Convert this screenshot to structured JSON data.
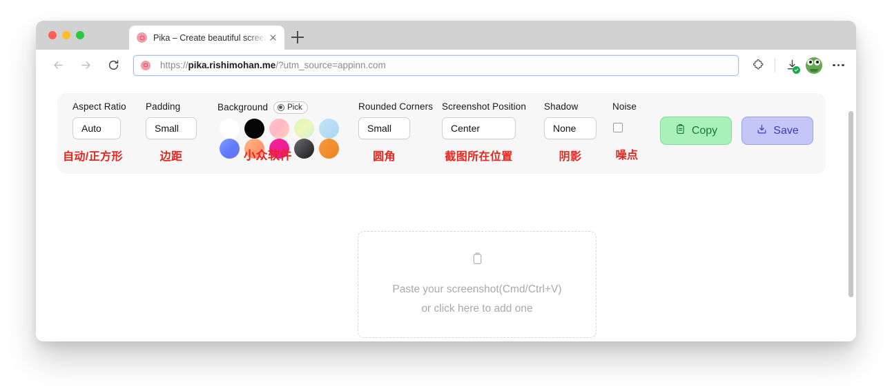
{
  "browser": {
    "tab": {
      "title": "Pika – Create beautiful screenshots",
      "favicon_name": "pika-favicon",
      "close_label": "×"
    },
    "new_tab_label": "+",
    "nav": {
      "back_icon": "back-arrow-icon",
      "forward_icon": "forward-arrow-icon",
      "reload_icon": "reload-icon",
      "extensions_icon": "extensions-puzzle-icon",
      "downloads_icon": "downloads-icon",
      "profile_icon": "frog-avatar-icon",
      "menu_icon": "more-options-icon"
    },
    "url": {
      "prefix": "https://",
      "domain": "pika.rishimohan.me",
      "suffix": "/?utm_source=appinn.com",
      "full": "https://pika.rishimohan.me/?utm_source=appinn.com"
    }
  },
  "toolbar": {
    "aspect_ratio": {
      "label": "Aspect Ratio",
      "value": "Auto",
      "annotation": "自动/正方形"
    },
    "padding": {
      "label": "Padding",
      "value": "Small",
      "annotation": "边距"
    },
    "background": {
      "label": "Background",
      "pick_label": "Pick",
      "watermark": "小众软件",
      "swatches": [
        {
          "name": "white",
          "css": "#ffffff"
        },
        {
          "name": "black",
          "css": "#050505"
        },
        {
          "name": "pink-gradient",
          "css": "linear-gradient(135deg,#ffc9c0,#ffb6c8 45%,#ffd4b5)"
        },
        {
          "name": "green-gradient",
          "css": "linear-gradient(135deg,#d8f5b8,#eef7bb 50%,#cdf0cf)"
        },
        {
          "name": "blue-gradient",
          "css": "linear-gradient(135deg,#bfe6f7,#b9dcf5 50%,#a9d8ef)"
        },
        {
          "name": "indigo-gradient",
          "css": "linear-gradient(135deg,#7f9cff,#5f7bfb 55%,#6f6df0)"
        },
        {
          "name": "orange-gradient",
          "css": "linear-gradient(135deg,#ffb787,#ff9b6e 55%,#ff8f79)"
        },
        {
          "name": "magenta",
          "css": "linear-gradient(135deg,#f8268f,#e8169c)"
        },
        {
          "name": "charcoal",
          "css": "linear-gradient(135deg,#6b6b6e,#3b3b3f 60%,#1d1d20)"
        },
        {
          "name": "orange",
          "css": "linear-gradient(135deg,#f79a3c,#ef8221)"
        }
      ]
    },
    "rounded_corners": {
      "label": "Rounded Corners",
      "value": "Small",
      "annotation": "圆角"
    },
    "screenshot_position": {
      "label": "Screenshot Position",
      "value": "Center",
      "annotation": "截图所在位置"
    },
    "shadow": {
      "label": "Shadow",
      "value": "None",
      "annotation": "阴影"
    },
    "noise": {
      "label": "Noise",
      "checked": false,
      "annotation": "噪点"
    },
    "copy_button": {
      "label": "Copy",
      "icon": "clipboard-icon",
      "color": "#aaf0bb"
    },
    "save_button": {
      "label": "Save",
      "icon": "download-icon",
      "color": "#c3c6f7"
    }
  },
  "dropzone": {
    "icon": "clipboard-icon",
    "line1": "Paste your screenshot(Cmd/Ctrl+V)",
    "line2": "or click here to add one"
  }
}
